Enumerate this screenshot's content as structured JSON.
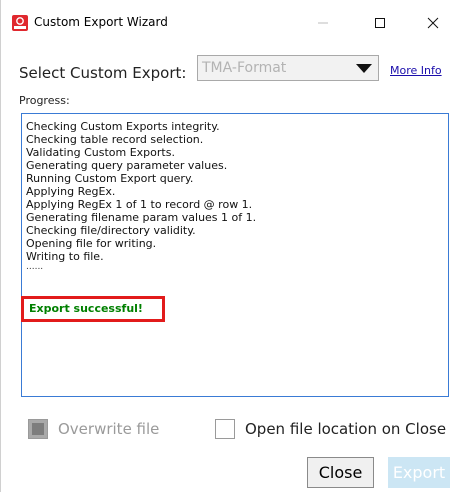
{
  "window": {
    "title": "Custom Export Wizard",
    "controls": {
      "minimize": "—",
      "maximize": "☐",
      "close": "✕"
    }
  },
  "export_select": {
    "label": "Select Custom Export:",
    "value": "TMA-Format",
    "more_info": "More Info"
  },
  "progress": {
    "label": "Progress:",
    "lines": [
      "Checking Custom Exports integrity.",
      "Checking table record selection.",
      "Validating Custom Exports.",
      "Generating query parameter values.",
      "Running Custom Export query.",
      "Applying RegEx.",
      "Applying RegEx 1 of 1 to record @ row 1.",
      "Generating filename param values 1 of 1.",
      "Checking file/directory validity.",
      "Opening file for writing.",
      "Writing to file."
    ],
    "dots": "......",
    "success": "Export successful!"
  },
  "options": {
    "overwrite_label": "Overwrite file",
    "open_location_label": "Open file location on Close"
  },
  "buttons": {
    "close": "Close",
    "export": "Export"
  },
  "colors": {
    "accent_border": "#3a7bd5",
    "success_text": "#008000",
    "highlight_box": "#e21b1b",
    "disabled_button_bg": "#cce6f4"
  }
}
